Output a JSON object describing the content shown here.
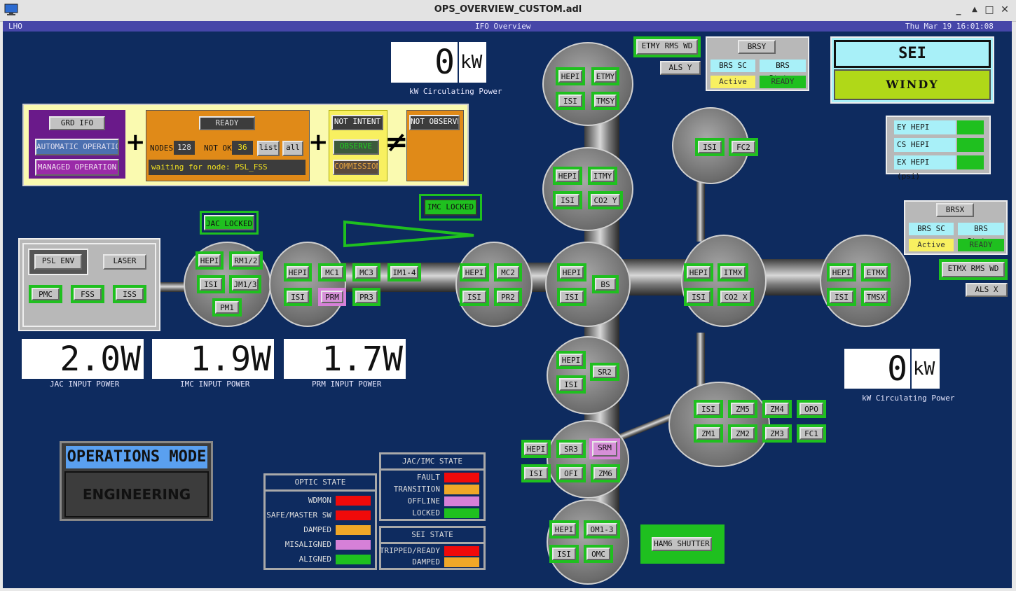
{
  "window": {
    "title": "OPS_OVERVIEW_CUSTOM.adl",
    "minimize": "_",
    "restore": "▲",
    "maximize": "□",
    "close": "✕"
  },
  "infobar": {
    "site": "LHO",
    "screen": "IFO Overview",
    "datetime": "Thu Mar 19 16:01:08 2026"
  },
  "top_power": {
    "value": "0",
    "unit": "kW",
    "label": "kW Circulating Power"
  },
  "right_power": {
    "value": "0",
    "unit": "kW",
    "label": "kW Circulating Power"
  },
  "guardian": {
    "grd_ifo": "GRD IFO",
    "automatic": "AUTOMATIC OPERATION",
    "managed": "MANAGED OPERATION",
    "ready": "READY",
    "nodes_label": "NODES",
    "nodes_value": "128",
    "notok_label": "NOT OK",
    "notok_value": "36",
    "list": "list",
    "all": "all",
    "waiting": "waiting for node: PSL_FSS",
    "not_intent": "NOT INTENT",
    "observe": "OBSERVE",
    "commission": "COMMISSION",
    "not_observe": "NOT OBSERVE",
    "plus": "+",
    "neq": "≠"
  },
  "psl": {
    "psl_env": "PSL ENV",
    "laser": "LASER",
    "pmc": "PMC",
    "fss": "FSS",
    "iss": "ISS"
  },
  "locks": {
    "jac": "JAC LOCKED",
    "imc": "IMC LOCKED"
  },
  "input_powers": [
    {
      "value": "2.0W",
      "label": "JAC INPUT POWER"
    },
    {
      "value": "1.9W",
      "label": "IMC INPUT POWER"
    },
    {
      "value": "1.7W",
      "label": "PRM INPUT POWER"
    }
  ],
  "ops_mode": {
    "title": "OPERATIONS MODE",
    "value": "ENGINEERING"
  },
  "optic_state": {
    "title": "OPTIC STATE",
    "rows": [
      {
        "label": "WDMON",
        "color": "#f00a0a"
      },
      {
        "label": "SAFE/MASTER SW",
        "color": "#f00a0a"
      },
      {
        "label": "DAMPED",
        "color": "#f0a828"
      },
      {
        "label": "MISALIGNED",
        "color": "#d680d8"
      },
      {
        "label": "ALIGNED",
        "color": "#1fc01f"
      }
    ]
  },
  "jac_state": {
    "title": "JAC/IMC STATE",
    "rows": [
      {
        "label": "FAULT",
        "color": "#f00a0a"
      },
      {
        "label": "TRANSITION",
        "color": "#f0a828"
      },
      {
        "label": "OFFLINE",
        "color": "#d680d8"
      },
      {
        "label": "LOCKED",
        "color": "#1fc01f"
      }
    ]
  },
  "sei_state": {
    "title": "SEI STATE",
    "rows": [
      {
        "label": "TRIPPED/READY",
        "color": "#f00a0a"
      },
      {
        "label": "DAMPED",
        "color": "#f0a828"
      }
    ]
  },
  "brsy": {
    "title": "BRSY",
    "sc": "BRS SC",
    "status": "BRS Status",
    "active": "Active",
    "ready": "READY",
    "rms": "ETMY RMS WD",
    "als": "ALS Y"
  },
  "brsx": {
    "title": "BRSX",
    "sc": "BRS SC",
    "status": "BRS Status",
    "active": "Active",
    "ready": "READY",
    "rms": "ETMX RMS WD",
    "als": "ALS X"
  },
  "sei_config": {
    "title": "SEI CONFIGURATION",
    "value": "WINDY"
  },
  "hepi_psi": [
    "EY HEPI (psi)",
    "CS HEPI (psi)",
    "EX HEPI (psi)"
  ],
  "ham6_shutter": "HAM6 SHUTTER",
  "chambers": {
    "ham1": [
      "HEPI",
      "RM1/2",
      "ISI",
      "JM1/3",
      "PM1"
    ],
    "ham2": [
      "HEPI",
      "MC1",
      "MC3",
      "IM1-4",
      "ISI",
      "PRM",
      "PR3"
    ],
    "ham3": [
      "HEPI",
      "MC2",
      "ISI",
      "PR2"
    ],
    "bsc2": [
      "HEPI",
      "ISI",
      "BS"
    ],
    "ham4": [
      "HEPI",
      "ISI",
      "SR2"
    ],
    "ham5": [
      "HEPI",
      "SR3",
      "SRM",
      "ISI",
      "OFI",
      "ZM6"
    ],
    "ham6": [
      "HEPI",
      "OM1-3",
      "ISI",
      "OMC"
    ],
    "bsc1": [
      "HEPI",
      "ETMY",
      "ISI",
      "TMSY"
    ],
    "bsc3": [
      "HEPI",
      "ITMY",
      "ISI",
      "CO2 Y"
    ],
    "ham8": [
      "ISI",
      "FC2"
    ],
    "itmx": [
      "HEPI",
      "ITMX",
      "ISI",
      "CO2 X"
    ],
    "etmx": [
      "HEPI",
      "ETMX",
      "ISI",
      "TMSX"
    ],
    "ham7": [
      "ISI",
      "ZM5",
      "ZM4",
      "OPO",
      "ZM1",
      "ZM2",
      "ZM3",
      "FC1"
    ]
  }
}
